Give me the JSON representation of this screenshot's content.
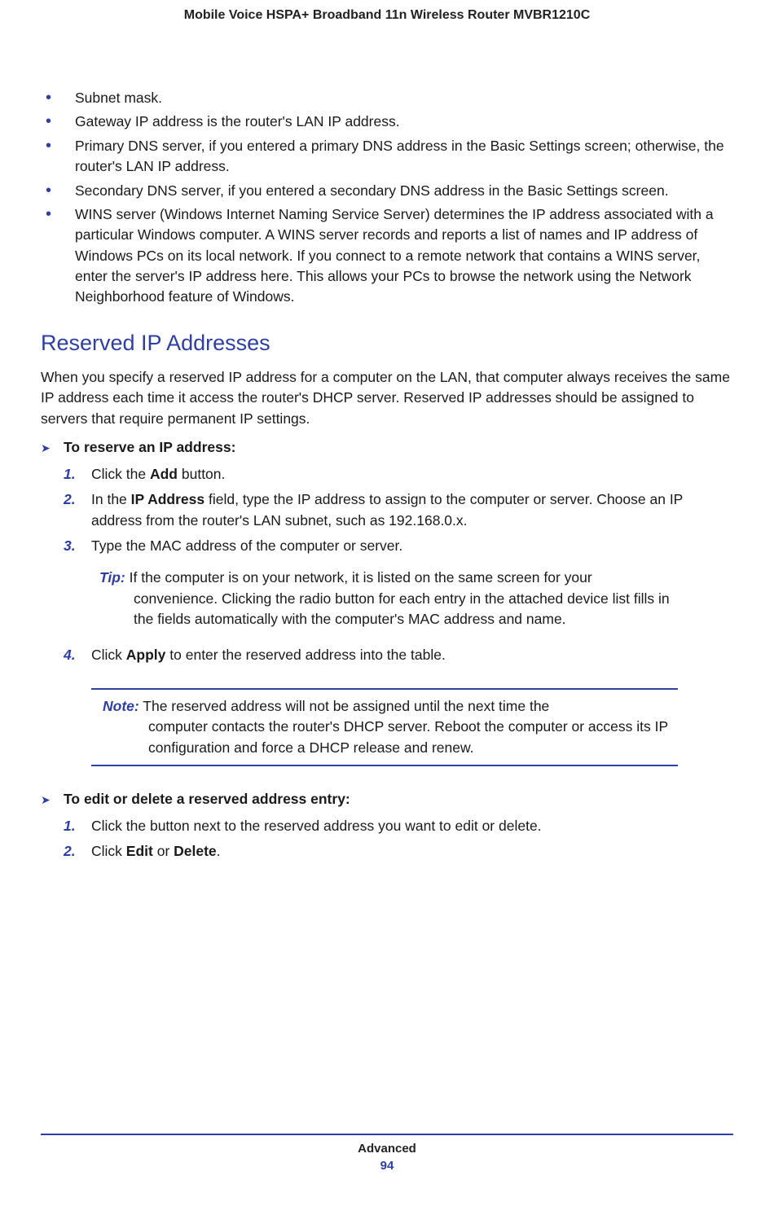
{
  "header": {
    "title": "Mobile Voice HSPA+ Broadband 11n Wireless Router MVBR1210C"
  },
  "bullets": [
    "Subnet mask.",
    "Gateway IP address is the router's LAN IP address.",
    "Primary DNS server, if you entered a primary DNS address in the Basic Settings screen; otherwise, the router's LAN IP address.",
    "Secondary DNS server, if you entered a secondary DNS address in the Basic Settings screen.",
    "WINS server (Windows Internet Naming Service Server) determines the IP address associated with a particular Windows computer. A WINS server records and reports a list of names and IP address of Windows PCs on its local network. If you connect to a remote network that contains a WINS server, enter the server's IP address here. This allows your PCs to browse the network using the Network Neighborhood feature of Windows."
  ],
  "section": {
    "heading": "Reserved IP Addresses",
    "intro": "When you specify a reserved IP address for a computer on the LAN, that computer always receives the same IP address each time it access the router's DHCP server. Reserved IP addresses should be assigned to servers that require permanent IP settings."
  },
  "proc1": {
    "title": "To reserve an IP address:",
    "steps": {
      "s1_pre": "Click the ",
      "s1_bold": "Add",
      "s1_post": " button.",
      "s2_pre": "In the ",
      "s2_bold": "IP Address",
      "s2_post": " field, type the IP address to assign to the computer or server. Choose an IP address from the router's LAN subnet, such as 192.168.0.x.",
      "s3": "Type the MAC address of the computer or server.",
      "s4_pre": "Click ",
      "s4_bold": "Apply",
      "s4_post": " to enter the reserved address into the table."
    }
  },
  "tip": {
    "label": "Tip:",
    "line_first": "If the computer is on your network, it is listed on the same screen for your",
    "line_rest": "convenience. Clicking the radio button for each entry in the attached device list fills in the fields automatically with the computer's MAC address and name."
  },
  "note": {
    "label": "Note:",
    "line_first": "The reserved address will not be assigned until the next time the",
    "line_rest": "computer contacts the router's DHCP server. Reboot the computer or access its IP configuration and force a DHCP release and renew."
  },
  "proc2": {
    "title": "To edit or delete a reserved address entry:",
    "steps": {
      "s1": "Click the button next to the reserved address you want to edit or delete.",
      "s2_pre": "Click ",
      "s2_b1": "Edit",
      "s2_mid": " or ",
      "s2_b2": "Delete",
      "s2_post": "."
    }
  },
  "footer": {
    "section": "Advanced",
    "page": "94"
  }
}
